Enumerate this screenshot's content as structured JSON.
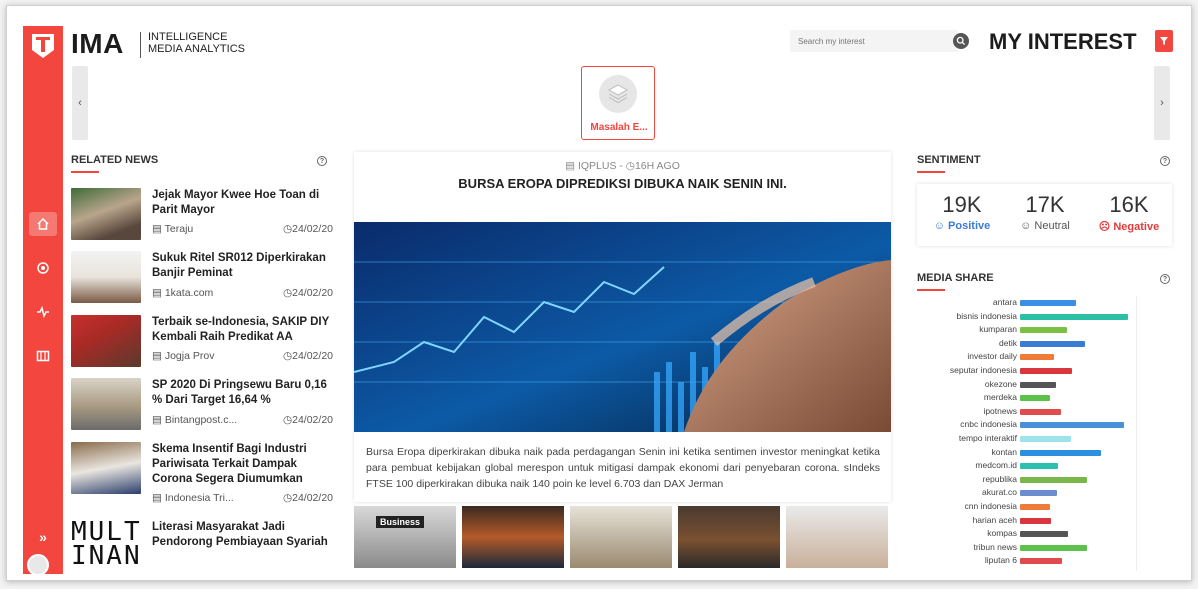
{
  "header": {
    "brand": "IMA",
    "brand_sub_line1": "INTELLIGENCE",
    "brand_sub_line2": "MEDIA ANALYTICS",
    "search_placeholder": "Search my interest",
    "my_interest": "MY INTEREST"
  },
  "carousel": {
    "prev": "‹",
    "next": "›",
    "active_item": "Masalah E..."
  },
  "related_news": {
    "title": "RELATED NEWS",
    "help": "?",
    "items": [
      {
        "title": "Jejak Mayor Kwee Hoe Toan di Parit Mayor",
        "source": "Teraju",
        "date": "24/02/20"
      },
      {
        "title": "Sukuk Ritel SR012 Diperkirakan Banjir Peminat",
        "source": "1kata.com",
        "date": "24/02/20"
      },
      {
        "title": "Terbaik se-Indonesia, SAKIP DIY Kembali Raih Predikat AA",
        "source": "Jogja Prov",
        "date": "24/02/20"
      },
      {
        "title": "SP 2020 Di Pringsewu Baru 0,16 % Dari Target 16,64 %",
        "source": "Bintangpost.c...",
        "date": "24/02/20"
      },
      {
        "title": "Skema Insentif Bagi Industri Pariwisata Terkait Dampak Corona Segera Diumumkan",
        "source": "Indonesia Tri...",
        "date": "24/02/20"
      },
      {
        "title": "Literasi Masyarakat Jadi Pendorong Pembiayaan Syariah",
        "source": "",
        "date": ""
      }
    ],
    "last_thumb_text_1": "MULT",
    "last_thumb_text_2": "INANC"
  },
  "article": {
    "source": "IQPLUS",
    "age": "16H AGO",
    "title": "BURSA EROPA DIPREDIKSI DIBUKA NAIK SENIN INI.",
    "body": "Bursa Eropa diperkirakan dibuka naik pada perdagangan Senin ini ketika sentimen investor meningkat ketika para pembuat kebijakan global merespon untuk mitigasi dampak ekonomi dari penyebaran corona. sIndeks FTSE 100 diperkirakan dibuka naik 140 poin ke level 6.703 dan DAX Jerman",
    "thumb_caption": "Business"
  },
  "sentiment": {
    "title": "SENTIMENT",
    "help": "?",
    "positive": {
      "value": "19K",
      "label": "Positive",
      "color": "#3a7bd5"
    },
    "neutral": {
      "value": "17K",
      "label": "Neutral",
      "color": "#555555"
    },
    "negative": {
      "value": "16K",
      "label": "Negative",
      "color": "#e23b3b"
    }
  },
  "media_share": {
    "title": "MEDIA SHARE",
    "help": "?"
  },
  "chart_data": {
    "type": "bar",
    "orientation": "horizontal",
    "title": "MEDIA SHARE",
    "categories": [
      "antara",
      "bisnis indonesia",
      "kumparan",
      "detik",
      "investor daily",
      "seputar indonesia",
      "okezone",
      "merdeka",
      "ipotnews",
      "cnbc indonesia",
      "tempo interaktif",
      "kontan",
      "medcom.id",
      "republika",
      "akurat.co",
      "cnn indonesia",
      "harian aceh",
      "kompas",
      "tribun news",
      "liputan 6"
    ],
    "values": [
      56,
      108,
      47,
      65,
      34,
      52,
      36,
      30,
      41,
      104,
      51,
      81,
      38,
      67,
      37,
      30,
      31,
      48,
      67,
      42
    ],
    "colors": [
      "#3a8ee6",
      "#2bc0a5",
      "#7ac143",
      "#3a7bd5",
      "#f07a3a",
      "#d9363e",
      "#555555",
      "#5cc24b",
      "#e14b4b",
      "#4a90d9",
      "#9fe3ea",
      "#2c8fe0",
      "#2cc0b0",
      "#7ab648",
      "#6b8ccf",
      "#f07a3a",
      "#d9363e",
      "#555555",
      "#5cc24b",
      "#e14b4b"
    ],
    "legend": false,
    "grid": false
  }
}
